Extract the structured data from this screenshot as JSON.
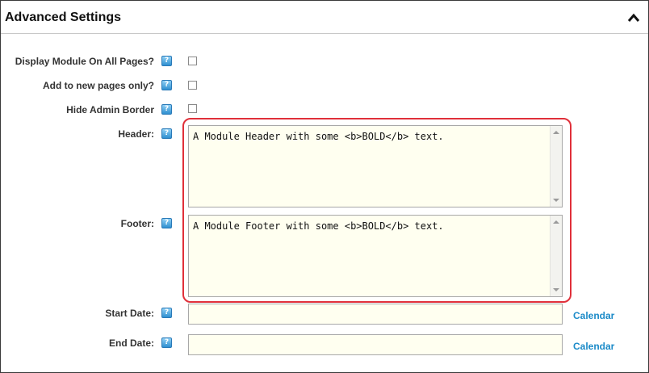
{
  "section": {
    "title": "Advanced Settings",
    "collapse_icon": "chevron-up-icon"
  },
  "help_icon_glyph": "?",
  "fields": {
    "display_all_pages": {
      "label": "Display Module On All Pages?",
      "checked": false
    },
    "new_pages_only": {
      "label": "Add to new pages only?",
      "checked": false
    },
    "hide_admin_border": {
      "label": "Hide Admin Border",
      "checked": false
    },
    "header": {
      "label": "Header:",
      "value": "A Module Header with some <b>BOLD</b> text."
    },
    "footer": {
      "label": "Footer:",
      "value": "A Module Footer with some <b>BOLD</b> text."
    },
    "start_date": {
      "label": "Start Date:",
      "value": "",
      "link": "Calendar"
    },
    "end_date": {
      "label": "End Date:",
      "value": "",
      "link": "Calendar"
    }
  },
  "colors": {
    "highlight": "#e0303a",
    "link": "#1a8ac8",
    "input_bg": "#fffff0"
  }
}
